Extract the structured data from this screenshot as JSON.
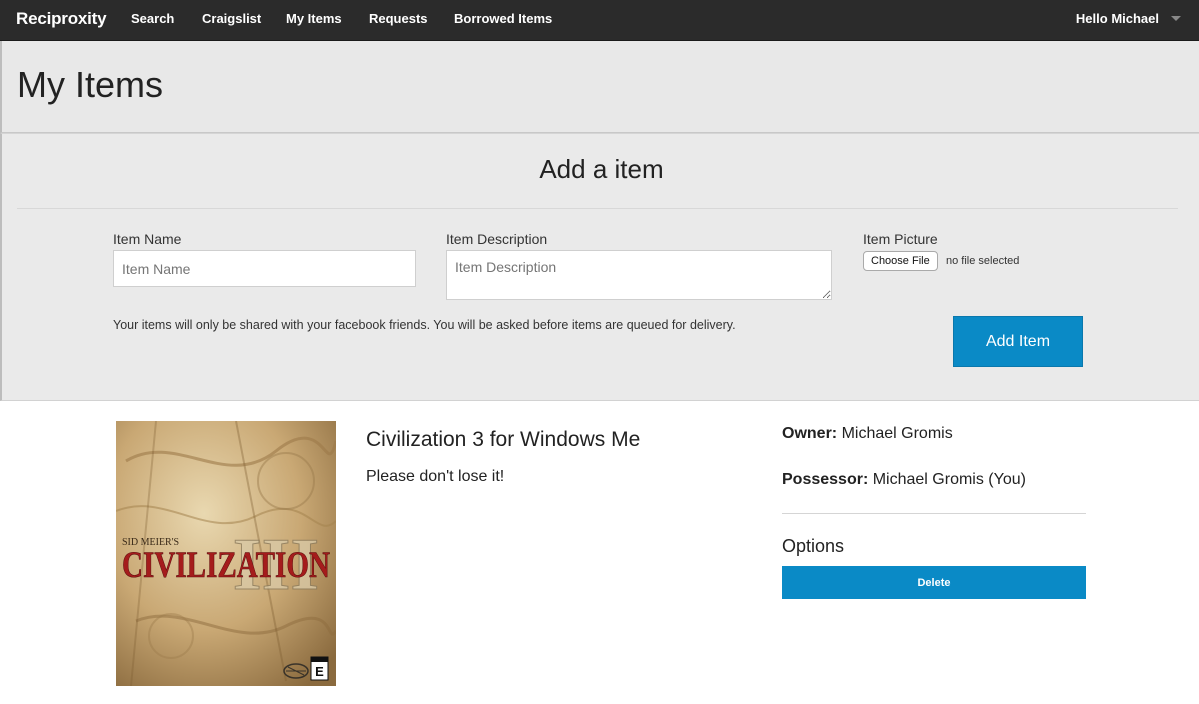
{
  "nav": {
    "brand": "Reciproxity",
    "links": [
      "Search",
      "Craigslist",
      "My Items",
      "Requests",
      "Borrowed Items"
    ],
    "user_greeting": "Hello Michael"
  },
  "page": {
    "title": "My Items"
  },
  "add_form": {
    "heading": "Add a item",
    "name_label": "Item Name",
    "name_placeholder": "Item Name",
    "description_label": "Item Description",
    "description_placeholder": "Item Description",
    "picture_label": "Item Picture",
    "choose_file_label": "Choose File",
    "file_status": "no file selected",
    "note": "Your items will only be shared with your facebook friends. You will be asked before items are queued for delivery.",
    "submit_label": "Add Item"
  },
  "items": [
    {
      "cover_text_top": "SID MEIER'S",
      "cover_text_main": "CIVILIZATION",
      "cover_numeral": "III",
      "rating": "E",
      "title": "Civilization 3 for Windows Me",
      "description": "Please don't lose it!",
      "owner_label": "Owner:",
      "owner": "Michael Gromis",
      "possessor_label": "Possessor:",
      "possessor": "Michael Gromis (You)",
      "options_heading": "Options",
      "delete_label": "Delete"
    }
  ],
  "colors": {
    "nav_bg": "#2b2b2b",
    "accent": "#0a8ac6",
    "panel_bg": "#eaeaea"
  }
}
